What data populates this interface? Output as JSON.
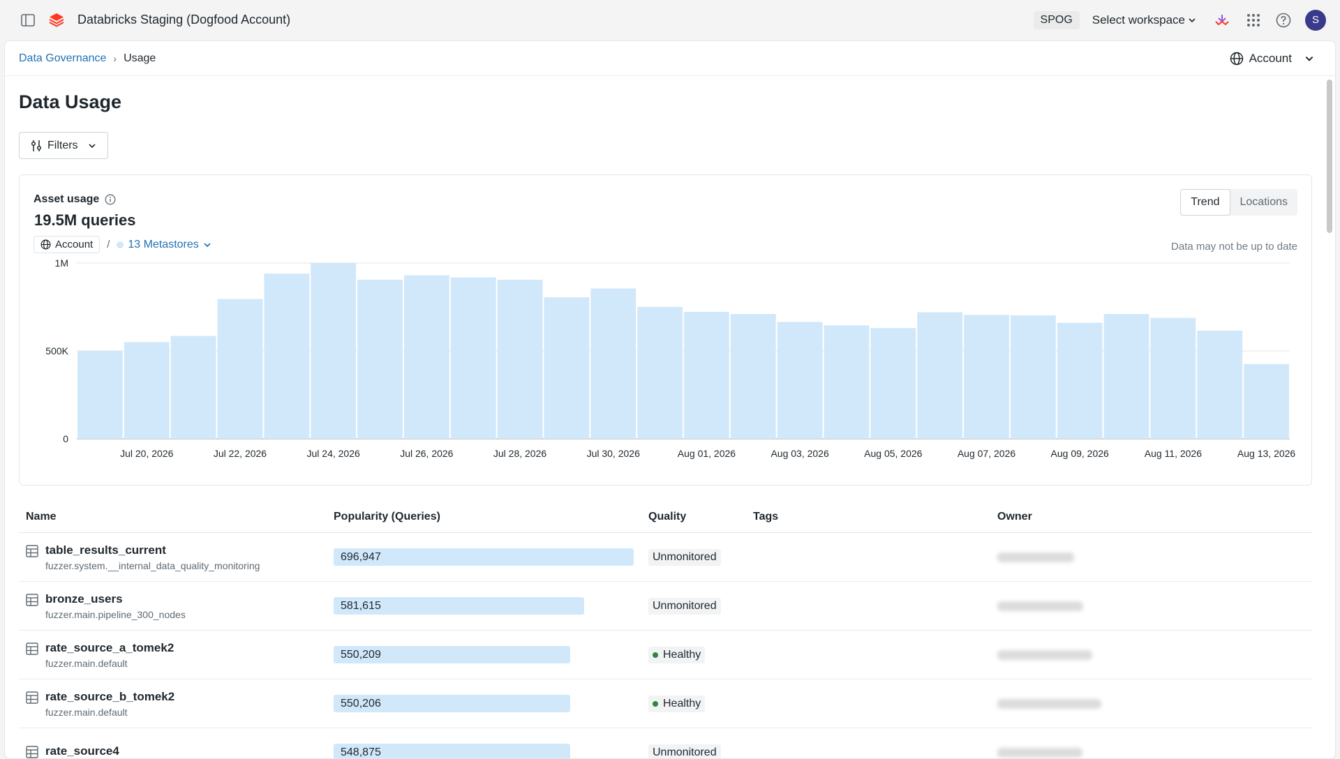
{
  "topbar": {
    "title": "Databricks Staging (Dogfood Account)",
    "spog": "SPOG",
    "workspace": "Select workspace",
    "avatar": "S"
  },
  "breadcrumb": {
    "parent": "Data Governance",
    "current": "Usage",
    "scope": "Account"
  },
  "page": {
    "title": "Data Usage",
    "filters_label": "Filters"
  },
  "usage_card": {
    "label": "Asset usage",
    "total": "19.5M queries",
    "scope_account": "Account",
    "scope_separator": "/",
    "metastores": "13 Metastores",
    "toggle": [
      "Trend",
      "Locations"
    ],
    "active_toggle": "Trend",
    "note": "Data may not be up to date"
  },
  "chart_data": {
    "type": "bar",
    "yticks": [
      "1M",
      "500K",
      "0"
    ],
    "ylim": [
      0,
      1000000
    ],
    "xtick_labels": [
      "Jul 20, 2026",
      "Jul 22, 2026",
      "Jul 24, 2026",
      "Jul 26, 2026",
      "Jul 28, 2026",
      "Jul 30, 2026",
      "Aug 01, 2026",
      "Aug 03, 2026",
      "Aug 05, 2026",
      "Aug 07, 2026",
      "Aug 09, 2026",
      "Aug 11, 2026",
      "Aug 13, 2026"
    ],
    "x": [
      "2026-07-19",
      "2026-07-20",
      "2026-07-21",
      "2026-07-22",
      "2026-07-23",
      "2026-07-24",
      "2026-07-25",
      "2026-07-26",
      "2026-07-27",
      "2026-07-28",
      "2026-07-29",
      "2026-07-30",
      "2026-07-31",
      "2026-08-01",
      "2026-08-02",
      "2026-08-03",
      "2026-08-04",
      "2026-08-05",
      "2026-08-06",
      "2026-08-07",
      "2026-08-08",
      "2026-08-09",
      "2026-08-10",
      "2026-08-11",
      "2026-08-12",
      "2026-08-13"
    ],
    "values": [
      500000,
      550000,
      585000,
      795000,
      940000,
      1000000,
      905000,
      930000,
      918000,
      905000,
      805000,
      855000,
      750000,
      722000,
      710000,
      665000,
      645000,
      630000,
      720000,
      705000,
      702000,
      660000,
      710000,
      688000,
      615000,
      425000
    ],
    "grid": true,
    "color": "#d1e8fb"
  },
  "table": {
    "headers": [
      "Name",
      "Popularity (Queries)",
      "Quality",
      "Tags",
      "Owner"
    ],
    "rows": [
      {
        "name": "table_results_current",
        "path": "fuzzer.system.__internal_data_quality_monitoring",
        "queries": "696,947",
        "queries_value": 696947,
        "quality": "Unmonitored",
        "healthy": false
      },
      {
        "name": "bronze_users",
        "path": "fuzzer.main.pipeline_300_nodes",
        "queries": "581,615",
        "queries_value": 581615,
        "quality": "Unmonitored",
        "healthy": false
      },
      {
        "name": "rate_source_a_tomek2",
        "path": "fuzzer.main.default",
        "queries": "550,209",
        "queries_value": 550209,
        "quality": "Healthy",
        "healthy": true
      },
      {
        "name": "rate_source_b_tomek2",
        "path": "fuzzer.main.default",
        "queries": "550,206",
        "queries_value": 550206,
        "quality": "Healthy",
        "healthy": true
      },
      {
        "name": "rate_source4",
        "path": "",
        "queries": "548,875",
        "queries_value": 548875,
        "quality": "Unmonitored",
        "healthy": false
      }
    ],
    "max_queries": 696947
  },
  "colors": {
    "link": "#2272b4",
    "bar": "#d1e8fb",
    "healthy": "#2e8540"
  }
}
